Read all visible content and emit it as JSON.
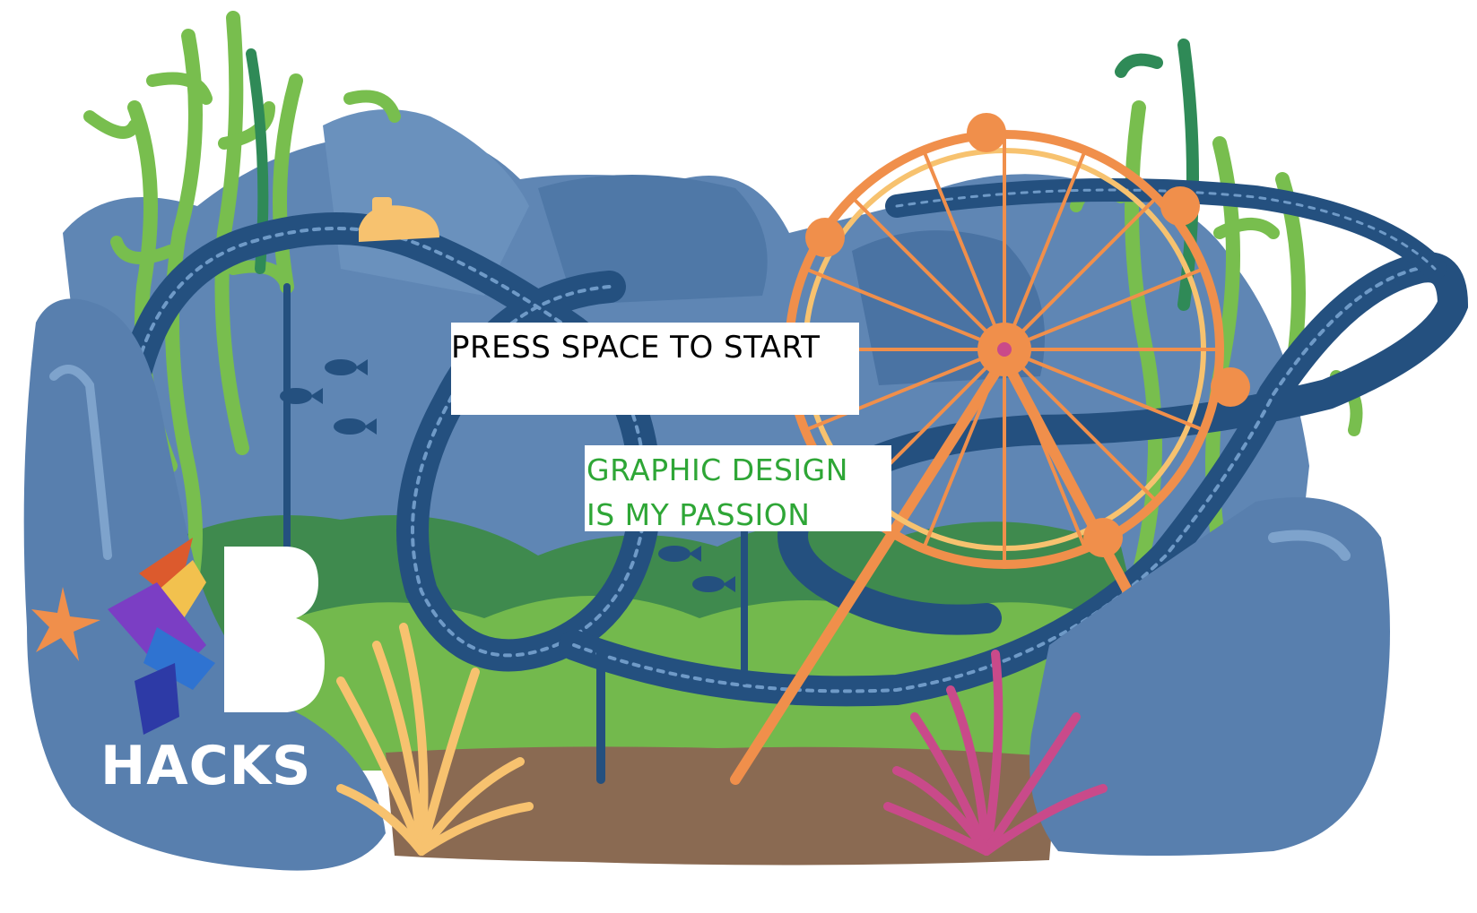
{
  "game": {
    "start_prompt": "PRESS SPACE TO START",
    "tagline_line1": "GRAPHIC DESIGN",
    "tagline_line2": "IS MY PASSION"
  },
  "logo": {
    "letter": "B",
    "wordmark": "HACKS"
  },
  "colors": {
    "rock": "#587fae",
    "rock_dark": "#3f6594",
    "track": "#24507f",
    "kelp": "#78be4e",
    "kelp_dark": "#2f8a57",
    "ferris": "#f08f4b",
    "ground": "#8a6a52",
    "hill": "#4f9a52",
    "coral_yellow": "#f7c26f",
    "coral_pink": "#c94a8a",
    "tagline": "#2ea636"
  },
  "icons": [
    "starfish-icon",
    "fish-icon",
    "submarine-icon",
    "ferris-wheel",
    "roller-coaster-track",
    "kelp",
    "coral"
  ]
}
